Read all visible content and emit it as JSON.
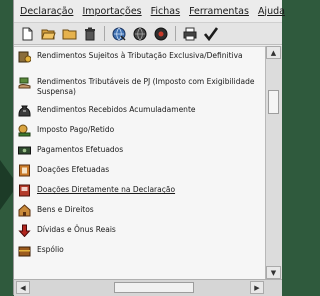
{
  "menu": [
    "Declaração",
    "Importações",
    "Fichas",
    "Ferramentas",
    "Ajuda"
  ],
  "toolbar": [
    {
      "name": "new-document-icon"
    },
    {
      "name": "open-folder-icon"
    },
    {
      "name": "folder-icon"
    },
    {
      "name": "delete-icon"
    },
    {
      "name": "globe-transmit-icon"
    },
    {
      "name": "globe-receive-icon"
    },
    {
      "name": "globe-icon"
    },
    {
      "name": "printer-icon"
    },
    {
      "name": "check-icon"
    }
  ],
  "tree": {
    "items": [
      {
        "label": "Rendimentos Sujeitos à Tributação Exclusiva/Definitiva",
        "icon": "building-money-icon"
      },
      {
        "label": "Rendimentos Tributáveis de PJ (Imposto com Exigibilidade Suspensa)",
        "icon": "hand-money-icon"
      },
      {
        "label": "Rendimentos Recebidos Acumuladamente",
        "icon": "money-bag-icon"
      },
      {
        "label": "Imposto Pago/Retido",
        "icon": "coins-icon"
      },
      {
        "label": "Pagamentos Efetuados",
        "icon": "banknote-icon"
      },
      {
        "label": "Doações Efetuadas",
        "icon": "gift-icon"
      },
      {
        "label": "Doações Diretamente na Declaração",
        "icon": "certificate-icon"
      },
      {
        "label": "Bens e Direitos",
        "icon": "house-icon"
      },
      {
        "label": "Dívidas e Ônus Reais",
        "icon": "down-arrow-icon"
      },
      {
        "label": "Espólio",
        "icon": "chest-icon"
      }
    ]
  },
  "colors": {
    "background": "#2f5a3d",
    "selected_underline": "#1a1a1a"
  }
}
